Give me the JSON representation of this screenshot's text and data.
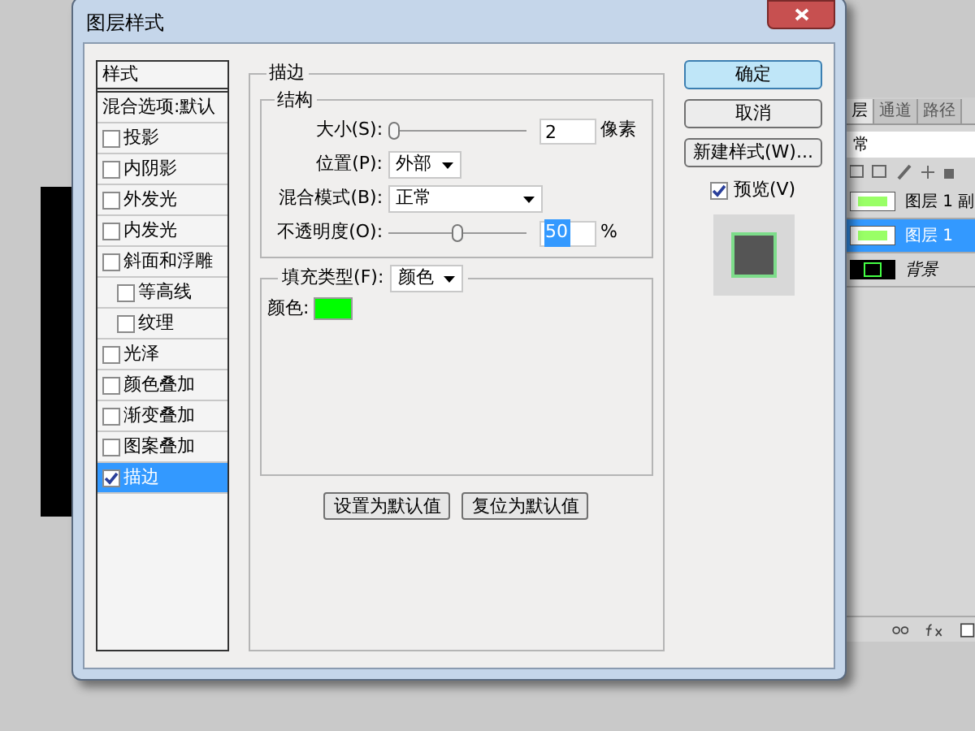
{
  "window": {
    "title": "图层样式"
  },
  "styles_list": {
    "header": "样式",
    "items": [
      {
        "label": "混合选项:默认",
        "kind": "plain",
        "selected": false
      },
      {
        "label": "投影",
        "kind": "check",
        "checked": false,
        "selected": false
      },
      {
        "label": "内阴影",
        "kind": "check",
        "checked": false,
        "selected": false
      },
      {
        "label": "外发光",
        "kind": "check",
        "checked": false,
        "selected": false
      },
      {
        "label": "内发光",
        "kind": "check",
        "checked": false,
        "selected": false
      },
      {
        "label": "斜面和浮雕",
        "kind": "check",
        "checked": false,
        "selected": false,
        "children": [
          {
            "label": "等高线",
            "kind": "check",
            "checked": false,
            "selected": false
          },
          {
            "label": "纹理",
            "kind": "check",
            "checked": false,
            "selected": false
          }
        ]
      },
      {
        "label": "光泽",
        "kind": "check",
        "checked": false,
        "selected": false
      },
      {
        "label": "颜色叠加",
        "kind": "check",
        "checked": false,
        "selected": false
      },
      {
        "label": "渐变叠加",
        "kind": "check",
        "checked": false,
        "selected": false
      },
      {
        "label": "图案叠加",
        "kind": "check",
        "checked": false,
        "selected": false
      },
      {
        "label": "描边",
        "kind": "check",
        "checked": true,
        "selected": true
      }
    ]
  },
  "stroke": {
    "title": "描边",
    "structure": {
      "title": "结构",
      "size": {
        "label": "大小(S):",
        "level": 0,
        "value": "2",
        "unit": "像素"
      },
      "position": {
        "label": "位置(P):",
        "value": "外部"
      },
      "blend_mode": {
        "label": "混合模式(B):",
        "value": "正常"
      },
      "opacity": {
        "label": "不透明度(O):",
        "level": 0.5,
        "value": "50",
        "value_selected": true,
        "unit": "%"
      }
    },
    "fill": {
      "label": "填充类型(F):",
      "value": "颜色",
      "color_label": "颜色:",
      "color": "#00ff00"
    },
    "buttons": [
      "设置为默认值",
      "复位为默认值"
    ]
  },
  "actions": [
    {
      "label": "确定",
      "default": true
    },
    {
      "label": "取消",
      "default": false
    },
    {
      "label": "新建样式(W)...",
      "default": false
    }
  ],
  "preview": {
    "label": "预览(V)",
    "checked": true
  },
  "layers_panel": {
    "tabs": [
      {
        "label": "层",
        "selected": true
      },
      {
        "label": "通道",
        "selected": false
      },
      {
        "label": "路径",
        "selected": false
      }
    ],
    "blend_mode": "常",
    "layers": [
      {
        "name": "图层 1 副",
        "kind": "layer",
        "selected": false
      },
      {
        "name": "图层 1",
        "kind": "layer",
        "selected": true
      },
      {
        "name": "背景",
        "kind": "background",
        "selected": false
      }
    ]
  }
}
